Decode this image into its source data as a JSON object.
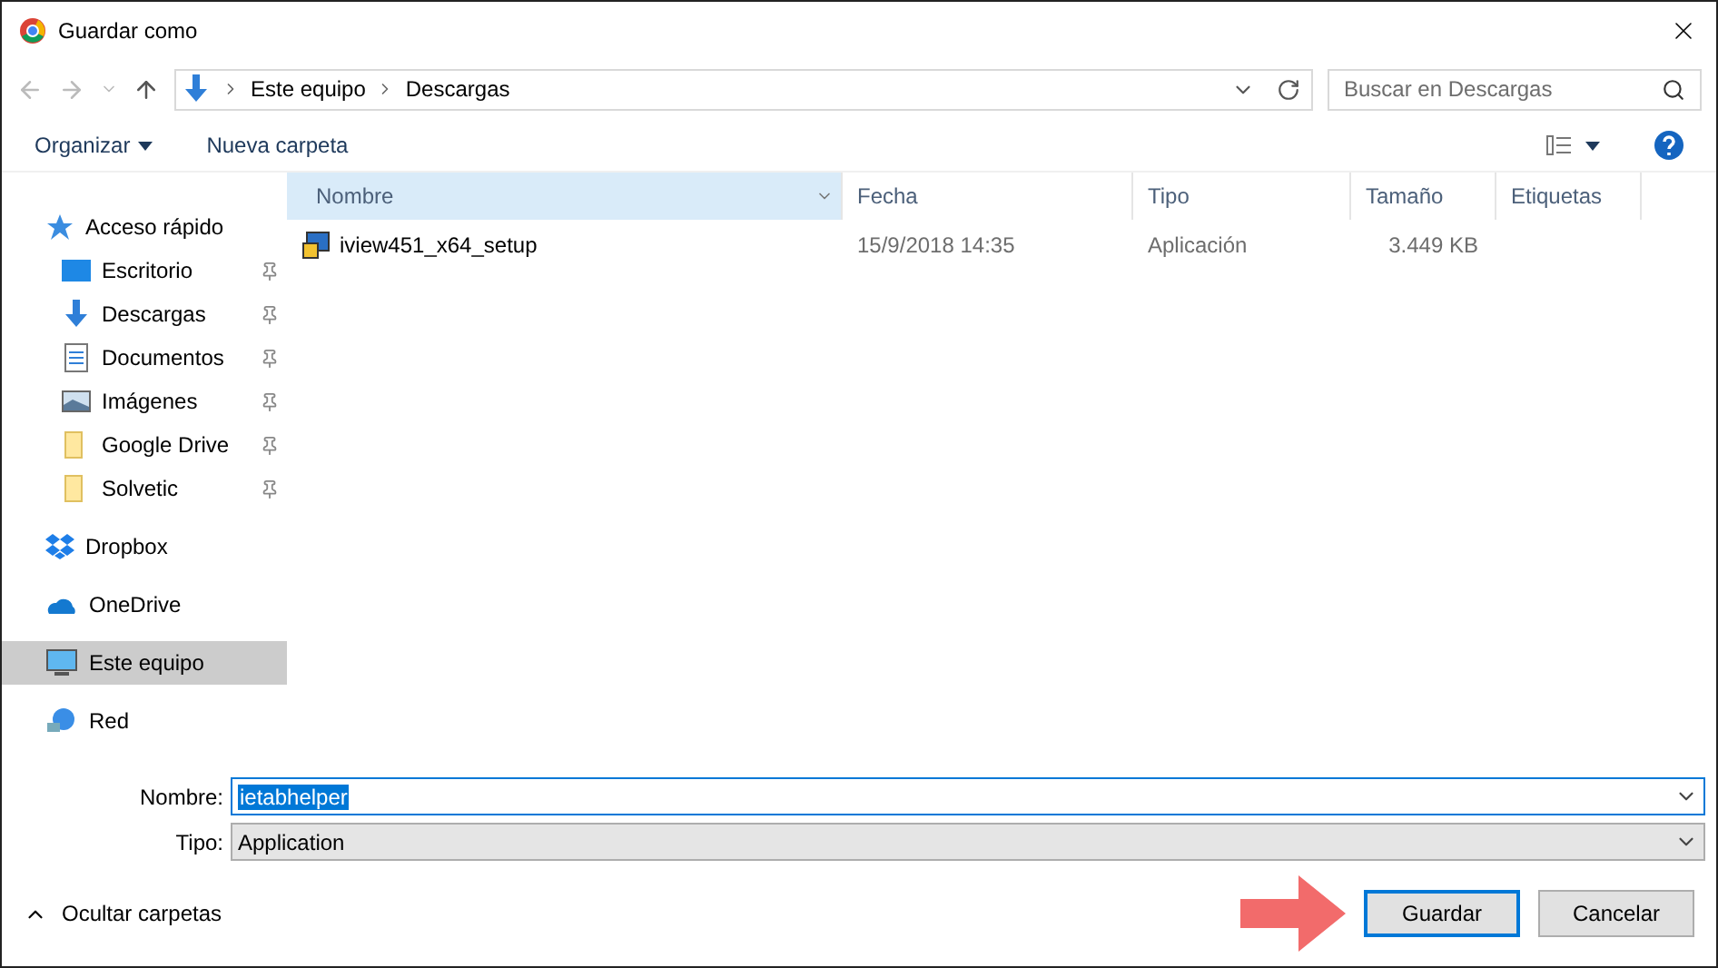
{
  "window": {
    "title": "Guardar como"
  },
  "breadcrumb": [
    "Este equipo",
    "Descargas"
  ],
  "search": {
    "placeholder": "Buscar en Descargas"
  },
  "toolbar": {
    "organize": "Organizar",
    "new_folder": "Nueva carpeta"
  },
  "sidebar": {
    "items": [
      {
        "label": "Acceso rápido",
        "kind": "group",
        "pinned": false,
        "selected": false
      },
      {
        "label": "Escritorio",
        "kind": "child",
        "pinned": true,
        "selected": false
      },
      {
        "label": "Descargas",
        "kind": "child",
        "pinned": true,
        "selected": false
      },
      {
        "label": "Documentos",
        "kind": "child",
        "pinned": true,
        "selected": false
      },
      {
        "label": "Imágenes",
        "kind": "child",
        "pinned": true,
        "selected": false
      },
      {
        "label": "Google Drive",
        "kind": "child",
        "pinned": true,
        "selected": false
      },
      {
        "label": "Solvetic",
        "kind": "child",
        "pinned": true,
        "selected": false
      },
      {
        "label": "Dropbox",
        "kind": "group",
        "pinned": false,
        "selected": false
      },
      {
        "label": "OneDrive",
        "kind": "group",
        "pinned": false,
        "selected": false
      },
      {
        "label": "Este equipo",
        "kind": "group",
        "pinned": false,
        "selected": true
      },
      {
        "label": "Red",
        "kind": "group",
        "pinned": false,
        "selected": false
      }
    ]
  },
  "table": {
    "columns": [
      {
        "label": "Nombre",
        "selected": true
      },
      {
        "label": "Fecha",
        "selected": false
      },
      {
        "label": "Tipo",
        "selected": false
      },
      {
        "label": "Tamaño",
        "selected": false
      },
      {
        "label": "Etiquetas",
        "selected": false
      }
    ],
    "rows": [
      {
        "name": "iview451_x64_setup",
        "date": "15/9/2018 14:35",
        "type": "Aplicación",
        "size": "3.449 KB"
      }
    ]
  },
  "form": {
    "name_label": "Nombre:",
    "name_value": "ietabhelper",
    "type_label": "Tipo:",
    "type_value": "Application"
  },
  "footer": {
    "hide_folders": "Ocultar carpetas",
    "save": "Guardar",
    "cancel": "Cancelar"
  }
}
